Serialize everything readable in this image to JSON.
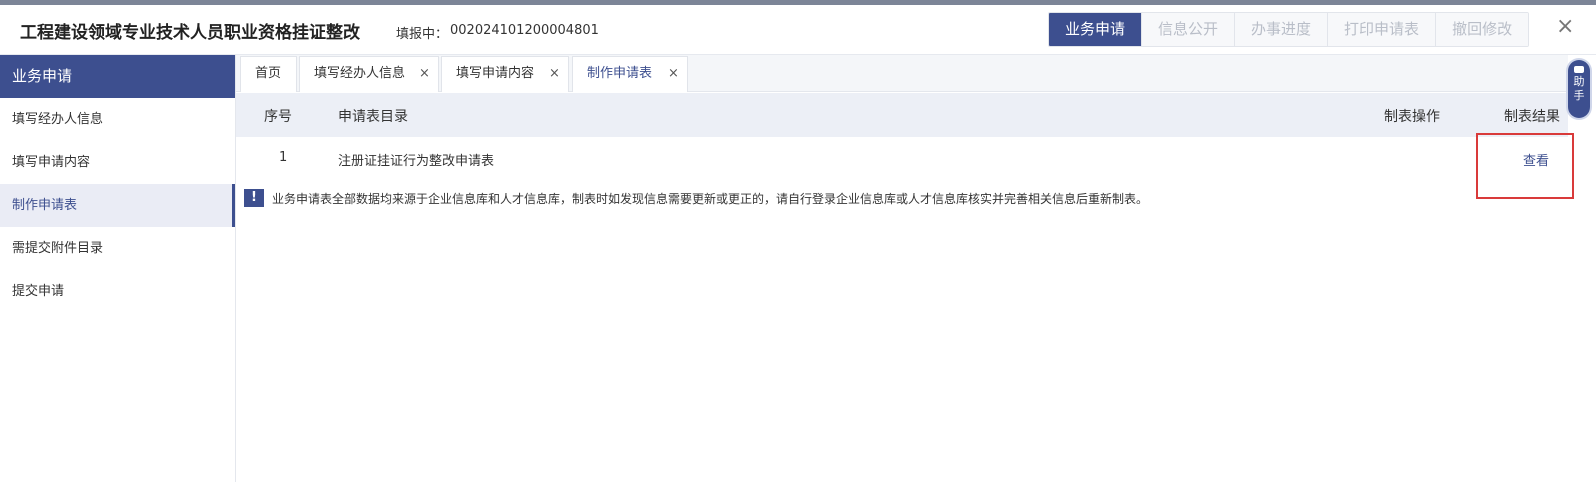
{
  "header": {
    "title": "工程建设领域专业技术人员职业资格挂证整改",
    "status_label": "填报中：",
    "application_number": "002024101200004801",
    "actions": [
      {
        "label": "业务申请",
        "active": true
      },
      {
        "label": "信息公开",
        "active": false
      },
      {
        "label": "办事进度",
        "active": false
      },
      {
        "label": "打印申请表",
        "active": false
      },
      {
        "label": "撤回修改",
        "active": false
      }
    ],
    "close": "×"
  },
  "sidebar": {
    "title": "业务申请",
    "items": [
      {
        "label": "填写经办人信息",
        "active": false
      },
      {
        "label": "填写申请内容",
        "active": false
      },
      {
        "label": "制作申请表",
        "active": true
      },
      {
        "label": "需提交附件目录",
        "active": false
      },
      {
        "label": "提交申请",
        "active": false
      }
    ]
  },
  "tabs": [
    {
      "label": "首页",
      "closable": false,
      "active": false
    },
    {
      "label": "填写经办人信息",
      "closable": true,
      "active": false
    },
    {
      "label": "填写申请内容",
      "closable": true,
      "active": false
    },
    {
      "label": "制作申请表",
      "closable": true,
      "active": true
    }
  ],
  "tab_close_glyph": "×",
  "table": {
    "columns": [
      "序号",
      "申请表目录",
      "制表操作",
      "制表结果"
    ],
    "rows": [
      {
        "index": "1",
        "name": "注册证挂证行为整改申请表",
        "operation": "",
        "result": "查看"
      }
    ]
  },
  "notice": {
    "icon": "!",
    "text": "业务申请表全部数据均来源于企业信息库和人才信息库，制表时如发现信息需要更新或更正的，请自行登录企业信息库或人才信息库核实并完善相关信息后重新制表。"
  },
  "assistant": {
    "label_1": "助",
    "label_2": "手"
  },
  "colors": {
    "primary": "#3d4f8f",
    "highlight": "#d93a3a",
    "table_header_bg": "#eceff6"
  }
}
